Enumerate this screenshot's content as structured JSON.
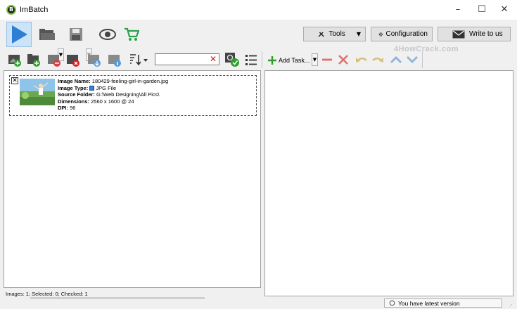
{
  "window": {
    "title": "ImBatch",
    "logo_letter": "B",
    "minimize_glyph": "–",
    "maximize_glyph": "☐",
    "close_glyph": "✕"
  },
  "toolbar_top": {
    "tools_label": "Tools",
    "configuration_label": "Configuration",
    "write_label": "Write to us"
  },
  "toolbar_tasks": {
    "add_task_label": "Add Task..."
  },
  "search": {
    "value": "",
    "placeholder": ""
  },
  "watermark": "4HowCrack.com",
  "images": [
    {
      "checked": true,
      "name_label": "Image Name:",
      "name": "180429-feeling-girl-in-garden.jpg",
      "type_label": "Image Type:",
      "type": "JPG File",
      "folder_label": "Source Folder:",
      "folder": "G:\\Web Designing\\All Pics\\",
      "dimensions_label": "Dimensions:",
      "dimensions": "2560 x 1600 @ 24",
      "dpi_label": "DPI:",
      "dpi": "96"
    }
  ],
  "status": {
    "summary": "Images: 1; Selected: 0; Checked: 1",
    "version": "You have latest version"
  },
  "colors": {
    "accent_blue": "#2d7fd3",
    "add_green": "#2f9e2f",
    "remove_red": "#d94040",
    "cart_green": "#2aa14a"
  }
}
